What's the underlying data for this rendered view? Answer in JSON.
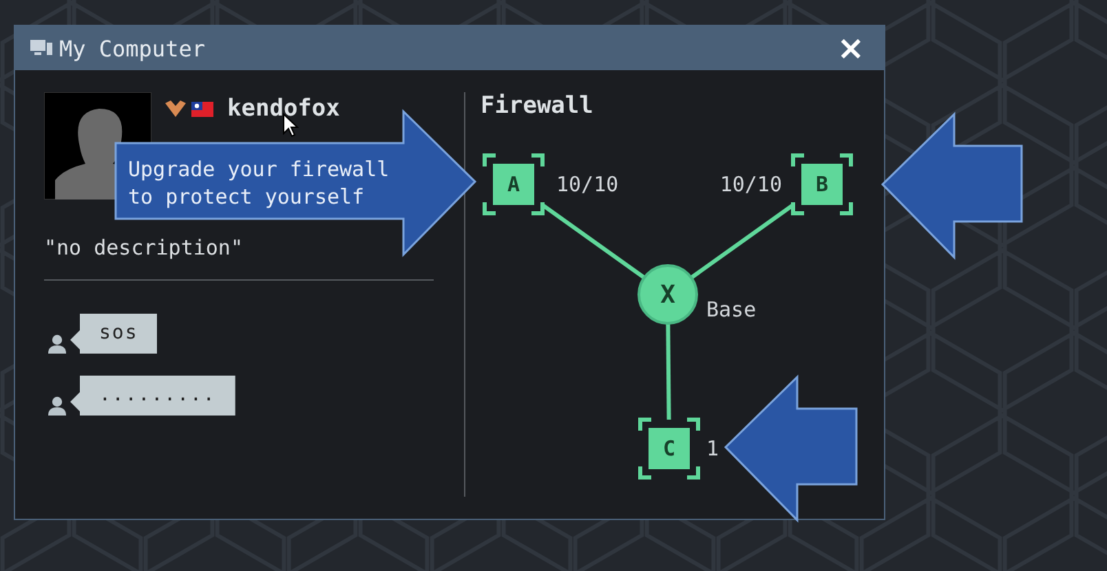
{
  "window": {
    "title": "My Computer",
    "close": "×"
  },
  "profile": {
    "name": "kendofox",
    "description": "\"no description\""
  },
  "messages": [
    {
      "text": "sos"
    },
    {
      "text": "........."
    }
  ],
  "firewall": {
    "title": "Firewall",
    "nodes": [
      {
        "kind": "slot",
        "label": "A",
        "value": "10/10"
      },
      {
        "kind": "slot",
        "label": "B",
        "value": "10/10"
      },
      {
        "kind": "base",
        "label": "X",
        "value": "Base"
      },
      {
        "kind": "slot",
        "label": "C",
        "value": "1"
      }
    ]
  },
  "annotations": [
    {
      "kind": "right-arrow",
      "text": "Upgrade your firewall to protect yourself"
    },
    {
      "kind": "left-arrow"
    },
    {
      "kind": "left-arrow"
    }
  ]
}
